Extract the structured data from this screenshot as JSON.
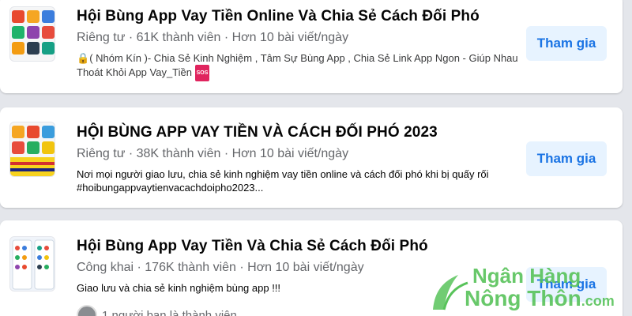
{
  "groups": [
    {
      "title": "Hội Bùng App Vay Tiền Online Và Chia Sẻ Cách Đối Phó",
      "meta": "Riêng tư · 61K thành viên · Hơn 10 bài viết/ngày",
      "description": "( Nhóm Kín )- Chia Sẻ Kinh Nghiệm , Tâm Sự Bùng App , Chia Sẻ Link App Ngon - Giúp Nhau Thoát Khỏi App Vay_Tiền",
      "description_badge": "SOS",
      "join_label": "Tham gia"
    },
    {
      "title": "HỘI BÙNG APP VAY TIỀN VÀ CÁCH ĐỐI PHÓ 2023",
      "meta": "Riêng tư · 38K thành viên · Hơn 10 bài viết/ngày",
      "description": "Nơi mọi người giao lưu, chia sẻ kinh nghiệm vay tiền online và cách đối phó khi bị quấy rối #hoibungappvaytienvacachdoipho2023...",
      "join_label": "Tham gia"
    },
    {
      "title": "Hội Bùng App Vay Tiền Và Chia Sẻ Cách Đối Phó",
      "meta": "Công khai · 176K thành viên · Hơn 10 bài viết/ngày",
      "description": "Giao lưu và chia sẻ kinh nghiệm bùng app !!!",
      "join_label": "Tham gia",
      "friends_text": "1 người bạn là thành viên"
    }
  ],
  "watermark": {
    "line1": "Ngân Hàng",
    "line2": "Nông Thôn",
    "suffix": ".com"
  },
  "colors": {
    "join_bg": "#e7f3ff",
    "join_text": "#1b74e4",
    "meta_text": "#65676b",
    "watermark": "#58c35a"
  }
}
